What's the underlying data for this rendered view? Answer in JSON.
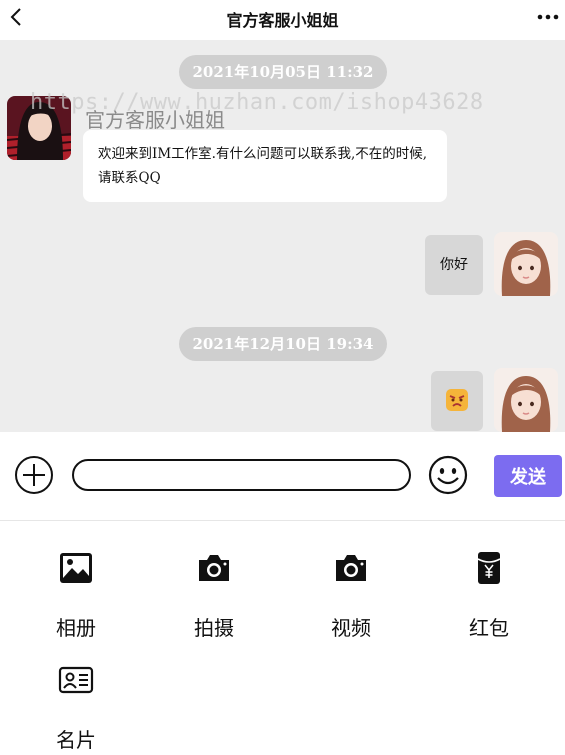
{
  "header": {
    "title": "官方客服小姐姐",
    "back_icon": "chevron-left-icon",
    "more_icon": "more-dots-icon"
  },
  "chat": {
    "watermark": "https://www.huzhan.com/ishop43628",
    "messages": [
      {
        "type": "time",
        "text": "2021年10月05日 11:32"
      },
      {
        "type": "received",
        "sender": "官方客服小姐姐",
        "text": "欢迎来到IM工作室.有什么问题可以联系我,不在的时候,请联系QQ"
      },
      {
        "type": "sent",
        "text": "你好"
      },
      {
        "type": "time",
        "text": "2021年12月10日 19:34"
      },
      {
        "type": "sent",
        "content": "emoji-sticker"
      }
    ]
  },
  "input": {
    "value": "",
    "send_label": "发送"
  },
  "tools": [
    {
      "label": "相册",
      "icon": "image-icon"
    },
    {
      "label": "拍摄",
      "icon": "camera-icon"
    },
    {
      "label": "视频",
      "icon": "camera-icon"
    },
    {
      "label": "红包",
      "icon": "red-packet-icon"
    },
    {
      "label": "名片",
      "icon": "contact-card-icon"
    }
  ],
  "colors": {
    "chat_bg": "#ededed",
    "send_button": "#7c6cf0",
    "time_pill": "#cfcfcf"
  }
}
